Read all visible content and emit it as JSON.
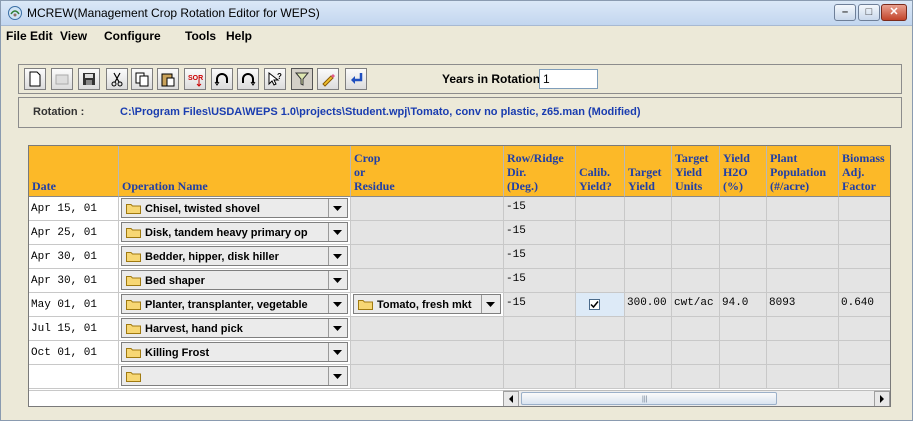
{
  "window": {
    "title": "MCREW(Management Crop Rotation Editor for WEPS)",
    "controls": {
      "minimize": "–",
      "maximize": "□",
      "close": "✕"
    }
  },
  "menu": {
    "items": [
      "File",
      "Edit",
      "View",
      "Configure",
      "Tools",
      "Help"
    ]
  },
  "toolbar": {
    "buttons": [
      "new-file-icon",
      "open-icon",
      "save-icon",
      "cut-icon",
      "copy-icon",
      "paste-icon",
      "sort-icon",
      "undo-icon",
      "redo-icon",
      "help-cursor-icon",
      "filter-icon",
      "edit-pencil-icon",
      "return-arrow-icon"
    ],
    "years_label": "Years in Rotation:",
    "years_value": "1"
  },
  "rotation": {
    "label": "Rotation :",
    "path": "C:\\Program Files\\USDA\\WEPS 1.0\\projects\\Student.wpj\\Tomato, conv no plastic, z65.man  (Modified)"
  },
  "colors": {
    "header": "#fcb928",
    "header_text": "#1f3fa8",
    "cell": "#e4e4e4"
  },
  "grid": {
    "headers": {
      "date": [
        "Date"
      ],
      "operation": [
        "Operation Name"
      ],
      "crop": [
        "Crop",
        "or",
        "Residue"
      ],
      "ridge": [
        "Row/Ridge",
        "Dir.",
        "(Deg.)"
      ],
      "calib": [
        "Calib.",
        "Yield?"
      ],
      "target": [
        "Target",
        "Yield"
      ],
      "units": [
        "Target",
        "Yield",
        "Units"
      ],
      "h2o": [
        "Yield",
        "H2O",
        "(%)"
      ],
      "pop": [
        "Plant",
        "Population",
        "(#/acre)"
      ],
      "biomass": [
        "Biomass",
        "Adj.",
        "Factor"
      ]
    },
    "rows": [
      {
        "date": "Apr 15, 01",
        "operation": "Chisel, twisted shovel",
        "crop": "",
        "ridge": "-15",
        "calib": false,
        "target": "",
        "units": "",
        "h2o": "",
        "pop": "",
        "biomass": ""
      },
      {
        "date": "Apr 25, 01",
        "operation": "Disk, tandem heavy primary op",
        "crop": "",
        "ridge": "-15",
        "calib": false,
        "target": "",
        "units": "",
        "h2o": "",
        "pop": "",
        "biomass": ""
      },
      {
        "date": "Apr 30, 01",
        "operation": "Bedder, hipper, disk hiller",
        "crop": "",
        "ridge": "-15",
        "calib": false,
        "target": "",
        "units": "",
        "h2o": "",
        "pop": "",
        "biomass": ""
      },
      {
        "date": "Apr 30, 01",
        "operation": "Bed shaper",
        "crop": "",
        "ridge": "-15",
        "calib": false,
        "target": "",
        "units": "",
        "h2o": "",
        "pop": "",
        "biomass": ""
      },
      {
        "date": "May 01, 01",
        "operation": "Planter, transplanter, vegetable",
        "crop": "Tomato, fresh mkt",
        "ridge": "-15",
        "calib": true,
        "target": "300.00",
        "units": "cwt/ac",
        "h2o": "94.0",
        "pop": "8093",
        "biomass": "0.640"
      },
      {
        "date": "Jul 15, 01",
        "operation": "Harvest, hand pick",
        "crop": "",
        "ridge": "",
        "calib": false,
        "target": "",
        "units": "",
        "h2o": "",
        "pop": "",
        "biomass": ""
      },
      {
        "date": "Oct 01, 01",
        "operation": "Killing Frost",
        "crop": "",
        "ridge": "",
        "calib": false,
        "target": "",
        "units": "",
        "h2o": "",
        "pop": "",
        "biomass": ""
      },
      {
        "date": "",
        "operation": "",
        "crop": "",
        "ridge": "",
        "calib": false,
        "target": "",
        "units": "",
        "h2o": "",
        "pop": "",
        "biomass": ""
      }
    ]
  }
}
